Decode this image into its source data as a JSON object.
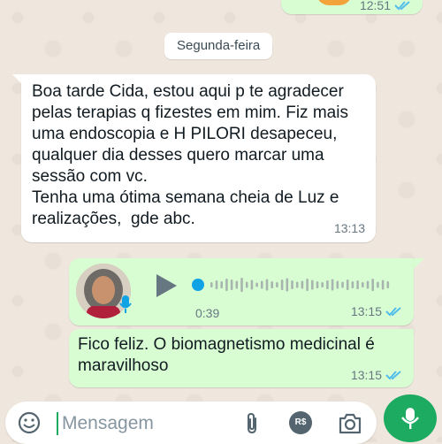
{
  "top_message": {
    "time": "12:51",
    "status": "read"
  },
  "date_separator": "Segunda-feira",
  "incoming_message": {
    "text": "Boa tarde Cida, estou aqui p te agradecer pelas terapias q fizestes em mim. Fiz mais uma endoscopia e H PILORI desapeceu,  qualquer dia desses quero marcar uma sessão com vc.\nTenha uma ótima semana cheia de Luz e realizações,  gde abc.",
    "time": "13:13"
  },
  "voice_message": {
    "duration": "0:39",
    "time": "13:15",
    "status": "read",
    "progress": 0,
    "icons": [
      "avatar",
      "mic-icon",
      "play-icon"
    ]
  },
  "outgoing_message": {
    "text": "Fico feliz.  O biomagnetismo medicinal é maravilhoso",
    "time": "13:15",
    "status": "read"
  },
  "composer": {
    "placeholder": "Mensagem",
    "value": "",
    "icons": [
      "emoji-icon",
      "attach-icon",
      "pix-icon",
      "camera-icon",
      "mic-icon"
    ],
    "pix_label": "R$"
  },
  "colors": {
    "outgoing_bubble": "#d9fdd3",
    "incoming_bubble": "#ffffff",
    "accent": "#1daa61",
    "read_ticks": "#53bdeb",
    "background": "#efe7dd"
  }
}
